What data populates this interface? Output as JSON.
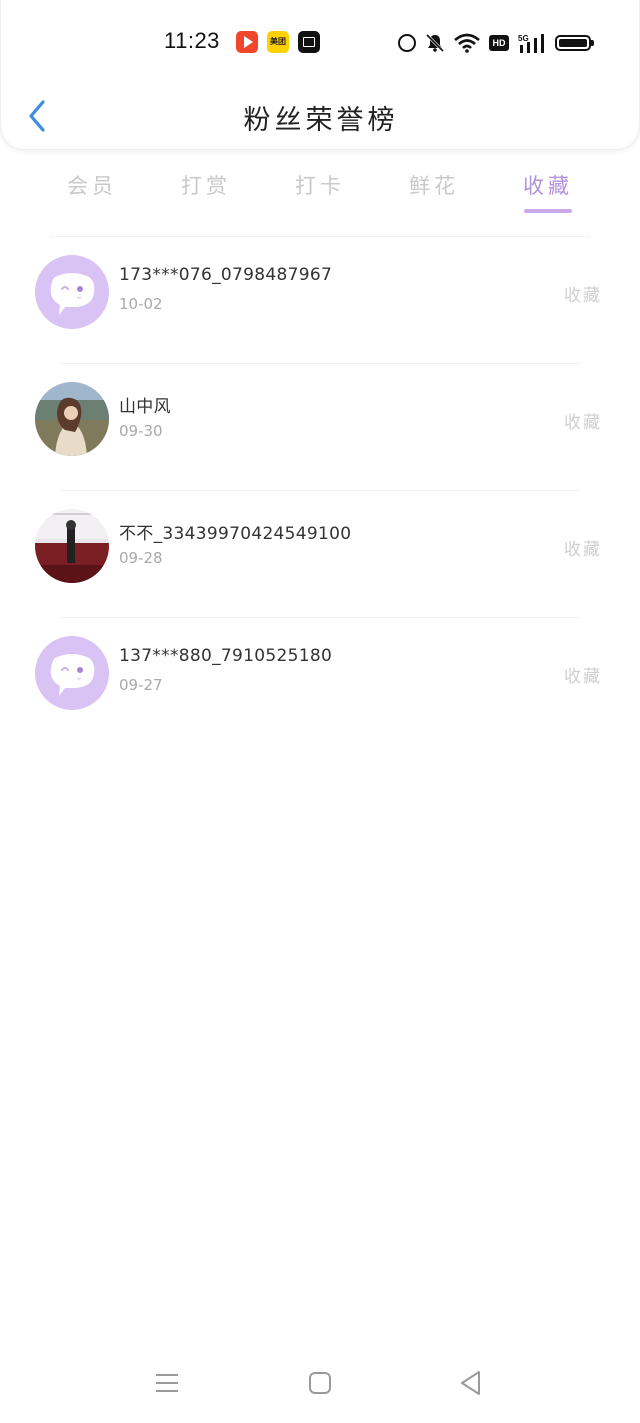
{
  "status_bar": {
    "time": "11:23",
    "apps": [
      "video-app-icon",
      "meituan-app-icon",
      "mail-app-icon"
    ],
    "meituan_label": "美团",
    "hd_label": "HD",
    "network_label": "5G",
    "battery_level": 1.0
  },
  "header": {
    "title": "粉丝荣誉榜"
  },
  "tabs": [
    {
      "label": "会员",
      "active": false
    },
    {
      "label": "打赏",
      "active": false
    },
    {
      "label": "打卡",
      "active": false
    },
    {
      "label": "鲜花",
      "active": false
    },
    {
      "label": "收藏",
      "active": true
    }
  ],
  "fans": [
    {
      "name": "173***076_0798487967",
      "date": "10-02",
      "type": "收藏",
      "avatar": "default-chat-avatar"
    },
    {
      "name": "山中风",
      "date": "09-30",
      "type": "收藏",
      "avatar": "photo-girl-outdoor"
    },
    {
      "name": "不不_33439970424549100",
      "date": "09-28",
      "type": "收藏",
      "avatar": "photo-dark-red"
    },
    {
      "name": "137***880_7910525180",
      "date": "09-27",
      "type": "收藏",
      "avatar": "default-chat-avatar"
    }
  ],
  "colors": {
    "accent": "#b592dc",
    "indicator": "#c8a9ea",
    "avatar_bg": "#d9c3f5",
    "back_arrow": "#3b8de0"
  }
}
